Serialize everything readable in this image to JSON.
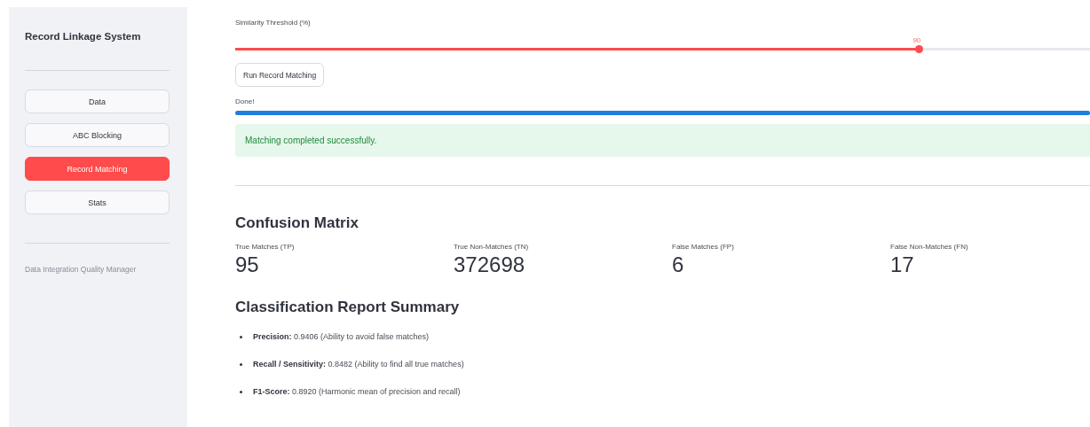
{
  "sidebar": {
    "title": "Record Linkage System",
    "items": [
      {
        "label": "Data",
        "selected": false
      },
      {
        "label": "ABC Blocking",
        "selected": false
      },
      {
        "label": "Record Matching",
        "selected": true
      },
      {
        "label": "Stats",
        "selected": false
      }
    ],
    "footer": "Data Integration Quality Manager"
  },
  "slider": {
    "label": "Similarity Threshold (%)",
    "value": "90",
    "level": 0.8
  },
  "run_button": "Run Record Matching",
  "progress": {
    "label": "Done!",
    "level": 1
  },
  "alert": "Matching completed successfully.",
  "confusion_matrix": {
    "heading": "Confusion Matrix",
    "metrics": [
      {
        "label": "True Matches (TP)",
        "value": "95"
      },
      {
        "label": "True Non-Matches (TN)",
        "value": "372698"
      },
      {
        "label": "False Matches (FP)",
        "value": "6"
      },
      {
        "label": "False Non-Matches (FN)",
        "value": "17"
      }
    ]
  },
  "report": {
    "heading": "Classification Report Summary",
    "items": [
      "**Precision:** 0.9406 (Ability to avoid false matches)",
      "**Recall / Sensitivity:** 0.8482 (Ability to find all true matches)",
      "**F1-Score:** 0.8920 (Harmonic mean of precision and recall)"
    ]
  }
}
